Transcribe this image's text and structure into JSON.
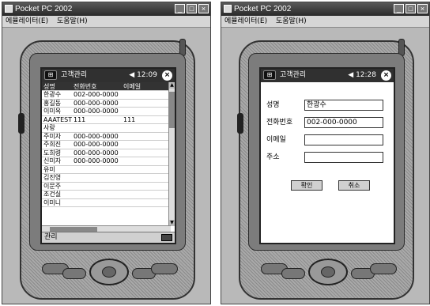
{
  "left_window": {
    "title": "Pocket PC 2002",
    "controls": [
      "_",
      "□",
      "×"
    ],
    "menu": [
      "에뮬레이터(E)",
      "도움말(H)"
    ],
    "screen": {
      "app_title": "고객관리",
      "clock": "12:09",
      "ok_label": "×",
      "columns": [
        "성명",
        "전화번호",
        "이메일"
      ],
      "rows": [
        {
          "name": "한광수",
          "phone": "002-000-0000",
          "email": ""
        },
        {
          "name": "홍길동",
          "phone": "000-000-0000",
          "email": ""
        },
        {
          "name": "이미옥",
          "phone": "000-000-0000",
          "email": ""
        },
        {
          "name": "AAATEST",
          "phone": "111",
          "email": "111"
        },
        {
          "name": "사랑",
          "phone": "",
          "email": ""
        },
        {
          "name": "주미자",
          "phone": "000-000-0000",
          "email": ""
        },
        {
          "name": "주희진",
          "phone": "000-000-0000",
          "email": ""
        },
        {
          "name": "도희령",
          "phone": "000-000-0000",
          "email": ""
        },
        {
          "name": "신미자",
          "phone": "000-000-0000",
          "email": ""
        },
        {
          "name": "유미",
          "phone": "",
          "email": ""
        },
        {
          "name": "김진영",
          "phone": "",
          "email": ""
        },
        {
          "name": "이문주",
          "phone": "",
          "email": ""
        },
        {
          "name": "조건실",
          "phone": "",
          "email": ""
        },
        {
          "name": "이미니",
          "phone": "",
          "email": ""
        }
      ],
      "command_bar": "관리"
    }
  },
  "right_window": {
    "title": "Pocket PC 2002",
    "controls": [
      "_",
      "□",
      "×"
    ],
    "menu": [
      "에뮬레이터(E)",
      "도움말(H)"
    ],
    "screen": {
      "app_title": "고객관리",
      "clock": "12:28",
      "ok_label": "×",
      "fields": [
        {
          "label": "성명",
          "value": "한광수"
        },
        {
          "label": "전화번호",
          "value": "002-000-0000"
        },
        {
          "label": "이메일",
          "value": ""
        },
        {
          "label": "주소",
          "value": ""
        }
      ],
      "confirm_button": "확인",
      "cancel_button": "취소"
    }
  }
}
